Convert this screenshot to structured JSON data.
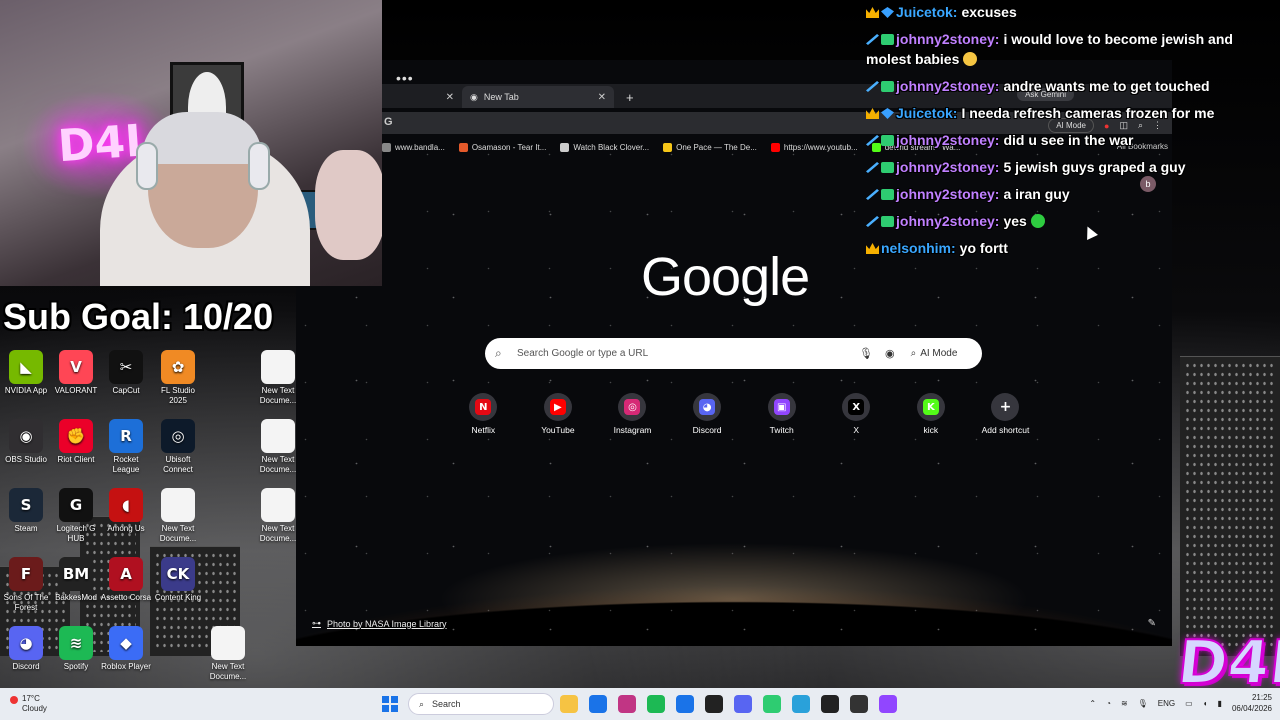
{
  "overlay": {
    "sub_goal": "Sub Goal: 10/20",
    "logo_text": "D4L"
  },
  "webcam": {
    "neon_sign": "D4L"
  },
  "chat": [
    {
      "badges": [
        "crown",
        "gem"
      ],
      "user": "Juicetok:",
      "user_color": "#3aa7ff",
      "text": "excuses",
      "emote": ""
    },
    {
      "badges": [
        "sword",
        "box"
      ],
      "user": "johnny2stoney:",
      "user_color": "#c080ff",
      "text": "i would love to become jewish and molest babies",
      "emote": "face"
    },
    {
      "badges": [
        "sword",
        "box"
      ],
      "user": "johnny2stoney:",
      "user_color": "#c080ff",
      "text": "andre wants me to get touched",
      "emote": ""
    },
    {
      "badges": [
        "crown",
        "gem"
      ],
      "user": "Juicetok:",
      "user_color": "#3aa7ff",
      "text": "I needa refresh cameras frozen for me",
      "emote": ""
    },
    {
      "badges": [
        "sword",
        "box"
      ],
      "user": "johnny2stoney:",
      "user_color": "#c080ff",
      "text": "did u see in the war",
      "emote": ""
    },
    {
      "badges": [
        "sword",
        "box"
      ],
      "user": "johnny2stoney:",
      "user_color": "#c080ff",
      "text": "5 jewish guys graped a guy",
      "emote": ""
    },
    {
      "badges": [
        "sword",
        "box"
      ],
      "user": "johnny2stoney:",
      "user_color": "#c080ff",
      "text": "a iran guy",
      "emote": ""
    },
    {
      "badges": [
        "sword",
        "box"
      ],
      "user": "johnny2stoney:",
      "user_color": "#c080ff",
      "text": "yes",
      "emote": "green"
    },
    {
      "badges": [
        "crown"
      ],
      "user": "nelsonhim:",
      "user_color": "#3aa7ff",
      "text": "yo fortt",
      "emote": ""
    }
  ],
  "desktop_icons": [
    {
      "label": "NVIDIA App",
      "glyph": "◣",
      "color": "#76b900"
    },
    {
      "label": "VALORANT",
      "glyph": "V",
      "color": "#ff4655"
    },
    {
      "label": "CapCut",
      "glyph": "✂",
      "color": "#111111"
    },
    {
      "label": "FL Studio 2025",
      "glyph": "✿",
      "color": "#f08a24"
    },
    {
      "label": "New Text Docume...",
      "glyph": "",
      "color": "#f4f4f4"
    },
    {
      "label": "OBS Studio",
      "glyph": "◉",
      "color": "#302e31"
    },
    {
      "label": "Riot Client",
      "glyph": "✊",
      "color": "#eb0029"
    },
    {
      "label": "Rocket League",
      "glyph": "R",
      "color": "#1d6fd8"
    },
    {
      "label": "Ubisoft Connect",
      "glyph": "◎",
      "color": "#0d1a2a"
    },
    {
      "label": "New Text Docume...",
      "glyph": "",
      "color": "#f4f4f4"
    },
    {
      "label": "Steam",
      "glyph": "S",
      "color": "#1b2838"
    },
    {
      "label": "Logitech G HUB",
      "glyph": "G",
      "color": "#111111"
    },
    {
      "label": "Among Us",
      "glyph": "◖",
      "color": "#c51111"
    },
    {
      "label": "New Text Docume...",
      "glyph": "",
      "color": "#f4f4f4"
    },
    {
      "label": "New Text Docume...",
      "glyph": "",
      "color": "#f4f4f4"
    },
    {
      "label": "Sons Of The Forest",
      "glyph": "F",
      "color": "#6b1b1b"
    },
    {
      "label": "BakkesMod",
      "glyph": "BM",
      "color": "#222222"
    },
    {
      "label": "Assetto Corsa",
      "glyph": "A",
      "color": "#b01020"
    },
    {
      "label": "Content King",
      "glyph": "CK",
      "color": "#3b3b8a"
    },
    {
      "label": "Discord",
      "glyph": "◕",
      "color": "#5865f2"
    },
    {
      "label": "Spotify",
      "glyph": "≋",
      "color": "#1db954"
    },
    {
      "label": "Roblox Player",
      "glyph": "◆",
      "color": "#3b6cf6"
    },
    {
      "label": "New Text Docume...",
      "glyph": "",
      "color": "#f4f4f4"
    }
  ],
  "browser": {
    "active_tab": "New Tab",
    "omnibox_initial": "G",
    "top_ai_mode": "AI Mode",
    "ask_gemini": "Ask Gemini",
    "all_bookmarks": "All Bookmarks",
    "profile_initial": "b",
    "bookmarks": [
      {
        "label": "www.bandla...",
        "color": "#888888"
      },
      {
        "label": "Osamason - Tear It...",
        "color": "#e55a2b"
      },
      {
        "label": "Watch Black Clover...",
        "color": "#cccccc"
      },
      {
        "label": "One Pace — The De...",
        "color": "#f5c518"
      },
      {
        "label": "https://www.youtub...",
        "color": "#ff0000"
      },
      {
        "label": "dewrld stream - Wa...",
        "color": "#53fc18"
      }
    ],
    "google_logo": "Google",
    "search_placeholder": "Search Google or type a URL",
    "ai_mode_label": "AI Mode",
    "shortcuts": [
      {
        "label": "Netflix",
        "glyph": "N",
        "color": "#e50914"
      },
      {
        "label": "YouTube",
        "glyph": "▶",
        "color": "#ff0000"
      },
      {
        "label": "Instagram",
        "glyph": "◎",
        "color": "#d62976"
      },
      {
        "label": "Discord",
        "glyph": "◕",
        "color": "#5865f2"
      },
      {
        "label": "Twitch",
        "glyph": "▣",
        "color": "#9146ff"
      },
      {
        "label": "X",
        "glyph": "X",
        "color": "#000000"
      },
      {
        "label": "kick",
        "glyph": "K",
        "color": "#53fc18"
      },
      {
        "label": "Add shortcut",
        "glyph": "+",
        "color": "transparent"
      }
    ],
    "photo_credit": "Photo by NASA Image Library"
  },
  "taskbar": {
    "temperature": "17°C",
    "weather": "Cloudy",
    "search_label": "Search",
    "language": "ENG",
    "time": "21:25",
    "date": "06/04/2026",
    "apps": [
      "#f6c343",
      "#1a73e8",
      "#c13584",
      "#1db954",
      "#1a73e8",
      "#222222",
      "#5865f2",
      "#2ecc71",
      "#2aa1da",
      "#222222",
      "#333333",
      "#9146ff"
    ]
  }
}
